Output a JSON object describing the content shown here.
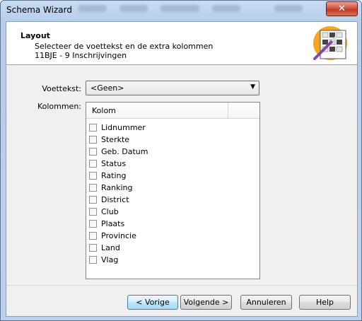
{
  "window": {
    "title": "Schema Wizard",
    "close_symbol": "✕"
  },
  "header": {
    "title": "Layout",
    "subtitle": "Selecteer de voettekst en de extra kolommen",
    "info": "11BJE - 9 Inschrijvingen"
  },
  "form": {
    "footer_label": "Voettekst:",
    "footer_value": "<Geen>",
    "columns_label": "Kolommen:"
  },
  "list": {
    "column_header": "Kolom",
    "items": [
      {
        "label": "Lidnummer",
        "checked": false
      },
      {
        "label": "Sterkte",
        "checked": false
      },
      {
        "label": "Geb. Datum",
        "checked": false
      },
      {
        "label": "Status",
        "checked": false
      },
      {
        "label": "Rating",
        "checked": false
      },
      {
        "label": "Ranking",
        "checked": false
      },
      {
        "label": "District",
        "checked": false
      },
      {
        "label": "Club",
        "checked": false
      },
      {
        "label": "Plaats",
        "checked": false
      },
      {
        "label": "Provincie",
        "checked": false
      },
      {
        "label": "Land",
        "checked": false
      },
      {
        "label": "Vlag",
        "checked": false
      }
    ]
  },
  "buttons": {
    "prev": "< Vorige",
    "next": "Volgende >",
    "cancel": "Annuleren",
    "help": "Help"
  }
}
